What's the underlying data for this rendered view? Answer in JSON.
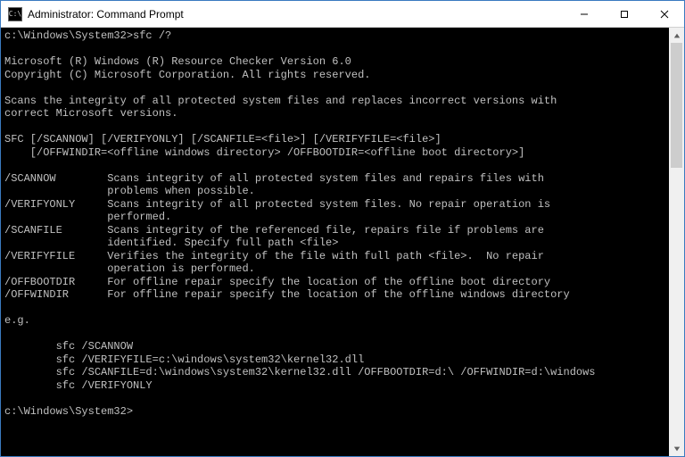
{
  "window": {
    "title": "Administrator: Command Prompt",
    "icon_label": "C:\\"
  },
  "terminal": {
    "line1": "c:\\Windows\\System32>sfc /?",
    "blank": "",
    "ms1": "Microsoft (R) Windows (R) Resource Checker Version 6.0",
    "ms2": "Copyright (C) Microsoft Corporation. All rights reserved.",
    "desc1": "Scans the integrity of all protected system files and replaces incorrect versions with",
    "desc2": "correct Microsoft versions.",
    "usage1": "SFC [/SCANNOW] [/VERIFYONLY] [/SCANFILE=<file>] [/VERIFYFILE=<file>]",
    "usage2": "    [/OFFWINDIR=<offline windows directory> /OFFBOOTDIR=<offline boot directory>]",
    "opt_scannow1": "/SCANNOW        Scans integrity of all protected system files and repairs files with",
    "opt_scannow2": "                problems when possible.",
    "opt_verify1": "/VERIFYONLY     Scans integrity of all protected system files. No repair operation is",
    "opt_verify2": "                performed.",
    "opt_scanfile1": "/SCANFILE       Scans integrity of the referenced file, repairs file if problems are",
    "opt_scanfile2": "                identified. Specify full path <file>",
    "opt_verfile1": "/VERIFYFILE     Verifies the integrity of the file with full path <file>.  No repair",
    "opt_verfile2": "                operation is performed.",
    "opt_offboot": "/OFFBOOTDIR     For offline repair specify the location of the offline boot directory",
    "opt_offwin": "/OFFWINDIR      For offline repair specify the location of the offline windows directory",
    "eg": "e.g.",
    "ex1": "        sfc /SCANNOW",
    "ex2": "        sfc /VERIFYFILE=c:\\windows\\system32\\kernel32.dll",
    "ex3": "        sfc /SCANFILE=d:\\windows\\system32\\kernel32.dll /OFFBOOTDIR=d:\\ /OFFWINDIR=d:\\windows",
    "ex4": "        sfc /VERIFYONLY",
    "prompt": "c:\\Windows\\System32>"
  }
}
